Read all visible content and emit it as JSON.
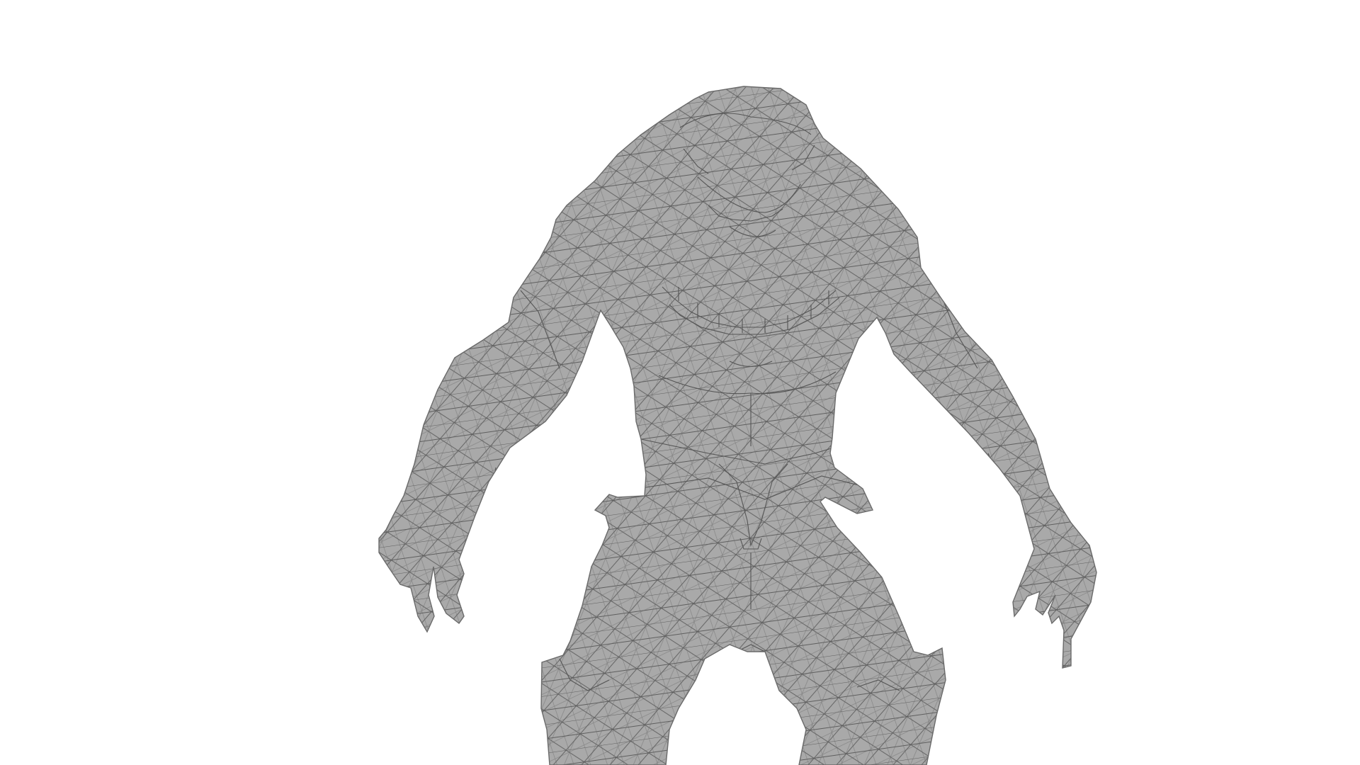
{
  "viewport": {
    "background": "#ffffff"
  },
  "model": {
    "subject": "creature-mesh",
    "fill_color": "#a9a9a9",
    "wire_color": "#555555",
    "render_mode": "wireframe-shaded"
  }
}
